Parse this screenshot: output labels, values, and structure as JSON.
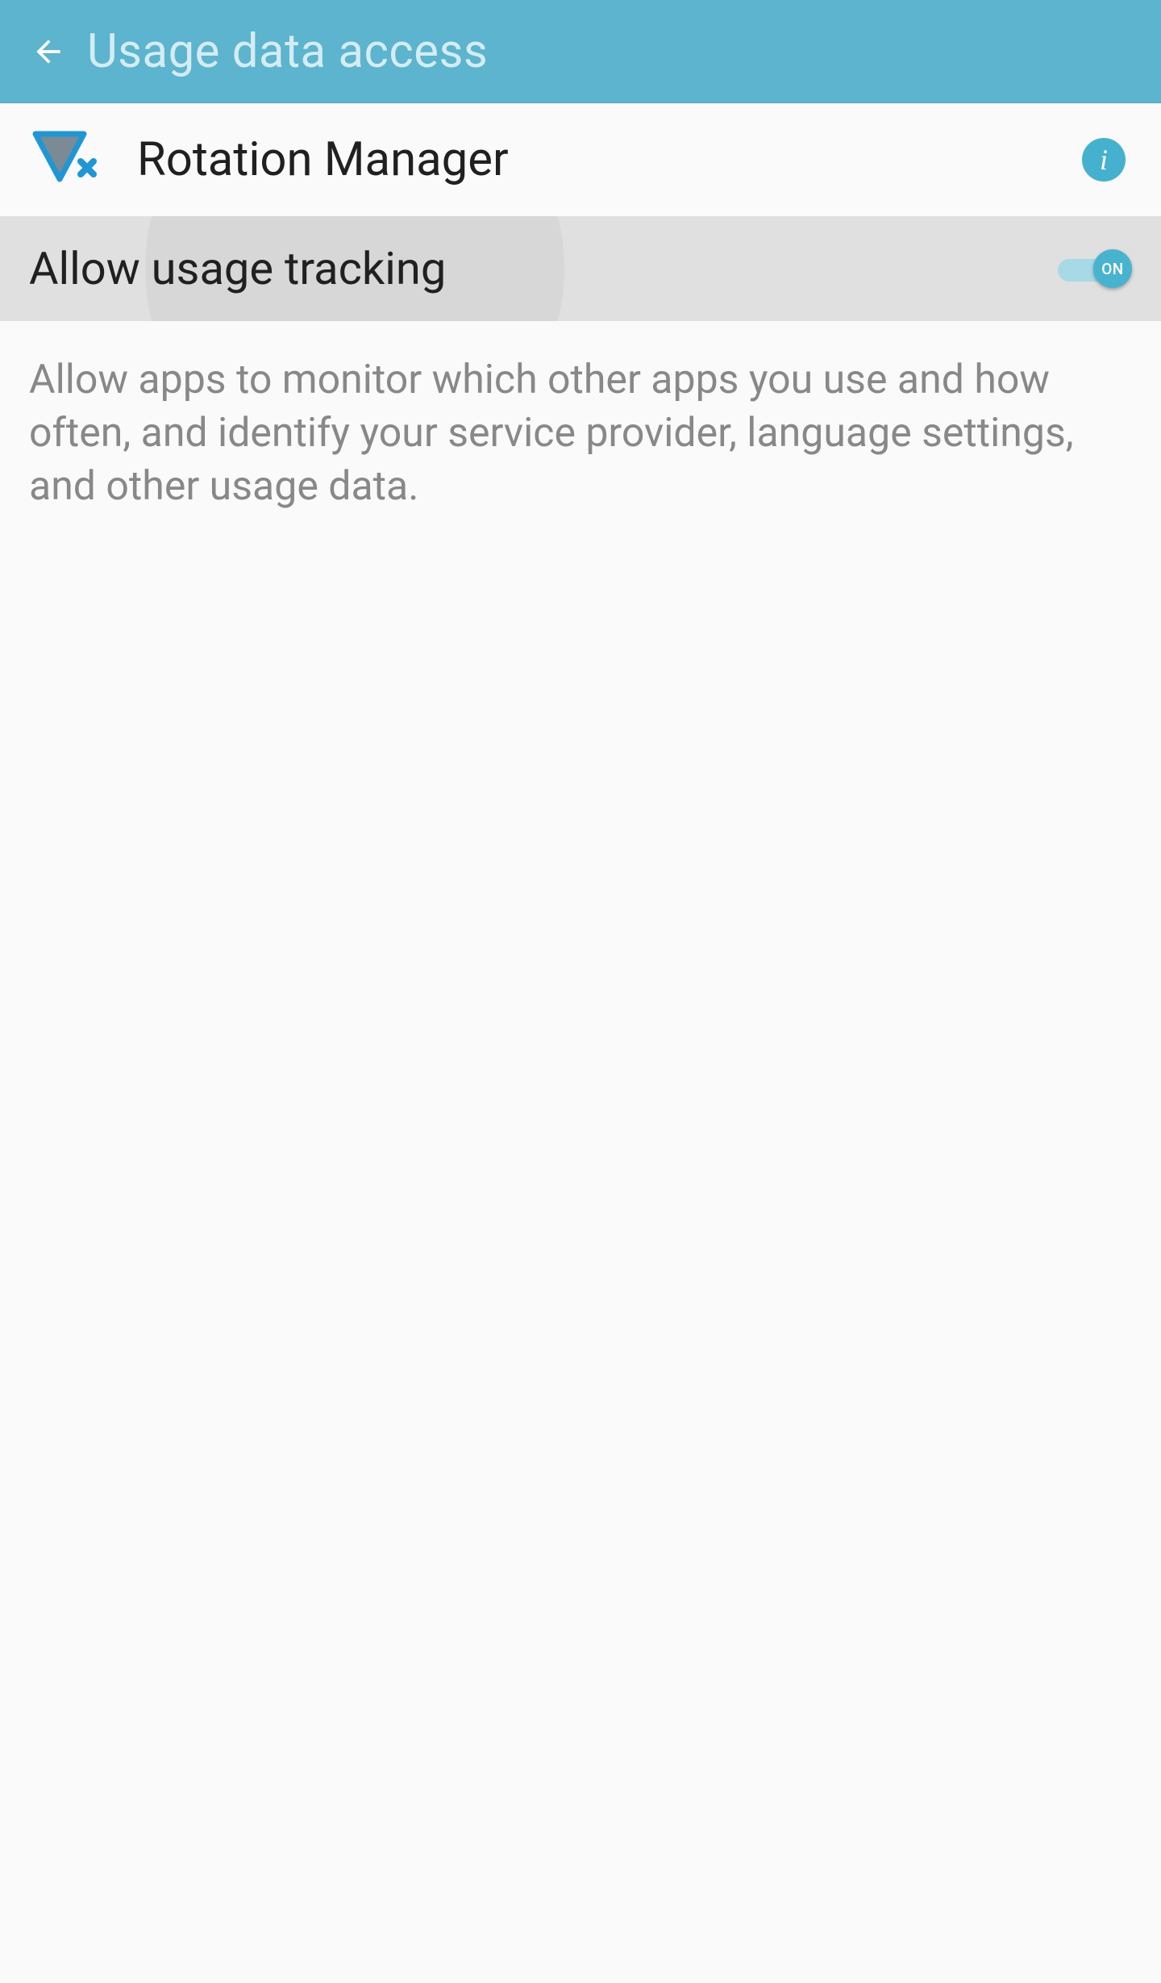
{
  "header": {
    "title": "Usage data access"
  },
  "app": {
    "name": "Rotation Manager",
    "icon_name": "rotation-manager-icon"
  },
  "toggle": {
    "label": "Allow usage tracking",
    "state": "ON",
    "enabled": true
  },
  "description": "Allow apps to monitor which other apps you use and how often, and identify your service provider, language settings, and other usage data.",
  "colors": {
    "header_bg": "#5cb4cf",
    "header_text": "#d4ecf2",
    "accent": "#48b3cf",
    "toggle_track": "#a8d9e6",
    "text_primary": "#202020",
    "text_secondary": "#888888"
  }
}
